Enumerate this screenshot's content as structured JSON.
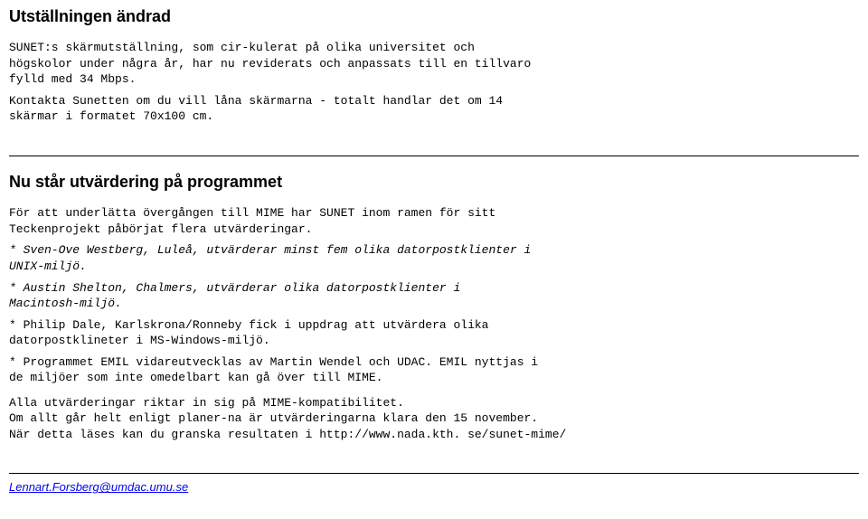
{
  "section1": {
    "title": "Utställningen ändrad",
    "para1": "SUNET:s skärmutställning, som cir-kulerat på olika universitet och\nhögskolor under några år, har nu reviderats och anpassats till en tillvaro\nfylld med 34 Mbps.",
    "para2": "Kontakta Sunetten om du vill låna skärmarna - totalt handlar det om 14\nskärmar i formatet 70x100 cm."
  },
  "section2": {
    "title": "Nu står utvärdering på programmet",
    "para1": "För att underlätta övergången till MIME har SUNET inom ramen för sitt\nTeckenprojekt påbörjat flera utvärderingar.",
    "bullet1": "* Sven-Ove Westberg, Luleå, utvärderar minst fem olika datorpostklienter i\nUNIX-miljö.",
    "bullet2": "* Austin Shelton, Chalmers, utvärderar olika datorpostklienter i\nMacintosh-miljö.",
    "bullet3": "* Philip Dale, Karlskrona/Ronneby fick i uppdrag att utvärdera olika\ndatorpostklineter i MS-Windows-miljö.",
    "bullet4": "* Programmet EMIL vidareutvecklas av Martin Wendel och UDAC. EMIL nyttjas i\nde miljöer som inte omedelbart kan gå över till MIME.",
    "para2": "Alla utvärderingar riktar in sig på MIME-kompatibilitet.\nOm allt går helt enligt planer-na är utvärderingarna klara den 15 november.\nNär detta läses kan du granska resultaten i http://www.nada.kth. se/sunet-mime/"
  },
  "footer": {
    "email": "Lennart.Forsberg@umdac.umu.se"
  }
}
